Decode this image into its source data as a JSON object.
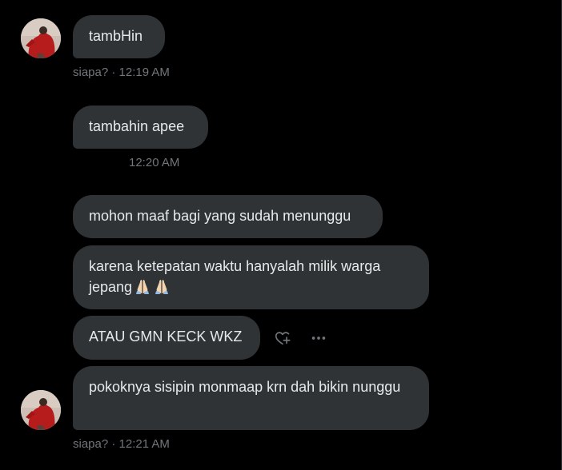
{
  "messages": [
    {
      "text": "tambHin"
    },
    {
      "text": "tambahin apee"
    },
    {
      "text": "mohon maaf bagi yang sudah menunggu"
    },
    {
      "text": "karena ketepatan waktu hanyalah milik warga jepang",
      "emoji": [
        "folded-hands",
        "folded-hands"
      ]
    },
    {
      "text": "ATAU GMN KECK WKZ"
    },
    {
      "text": "pokoknya sisipin monmaap krn dah bikin nunggu"
    }
  ],
  "meta": {
    "group1": "siapa? · 12:19 AM",
    "group2": "12:20 AM",
    "group3": "siapa? · 12:21 AM"
  },
  "icons": {
    "reaction": "heart-plus-icon",
    "more": "more-horizontal-icon"
  },
  "colors": {
    "background": "#000000",
    "bubble": "#2f3336",
    "text": "#e7e9ea",
    "muted": "#71767b"
  }
}
